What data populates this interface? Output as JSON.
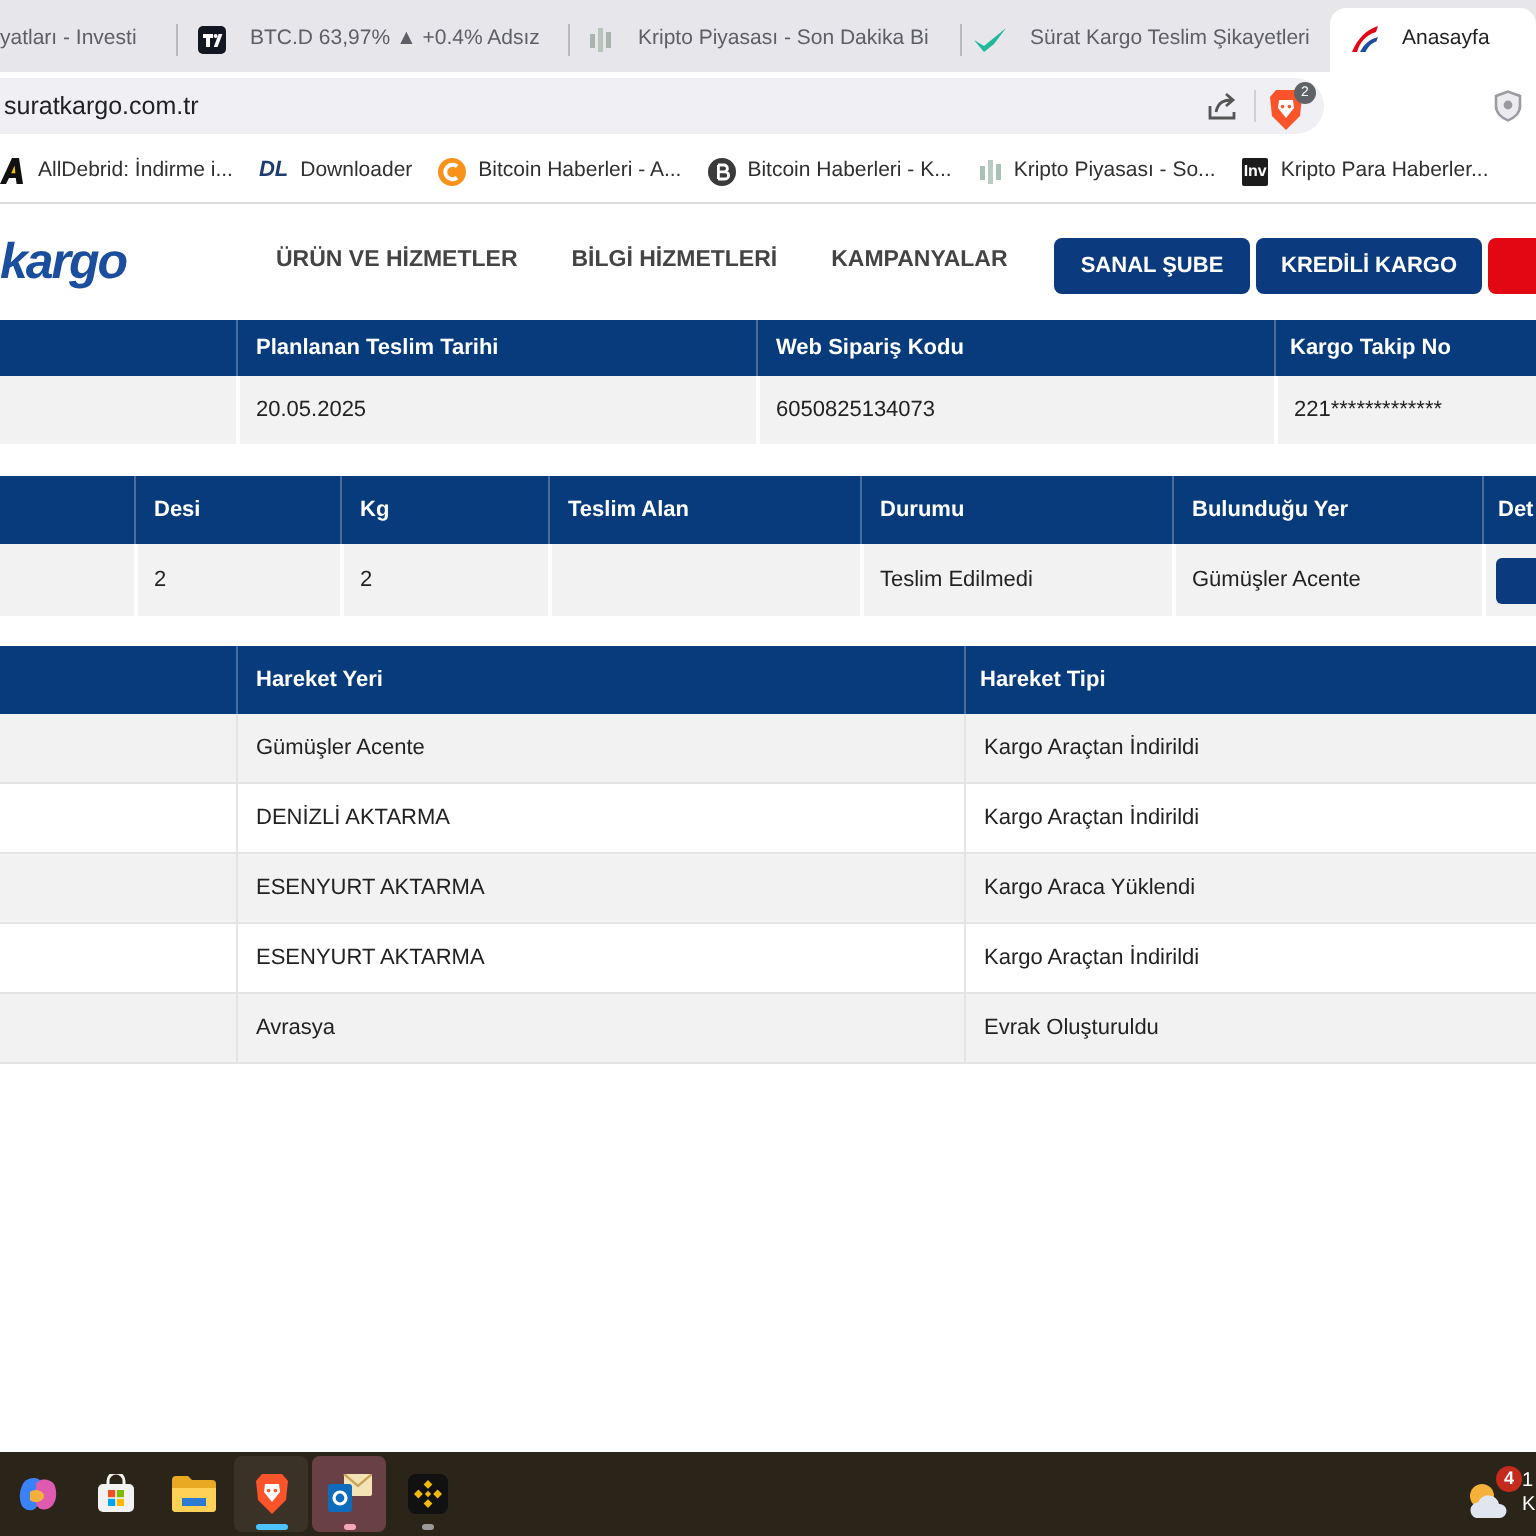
{
  "browser": {
    "tabs": [
      {
        "title": "yatları - Investi",
        "selected": false
      },
      {
        "title": "BTC.D 63,97% ▲ +0.4% Adsız",
        "selected": false
      },
      {
        "title": "Kripto Piyasası - Son Dakika Bi",
        "selected": false
      },
      {
        "title": "Sürat Kargo Teslim Şikayetleri",
        "selected": false
      },
      {
        "title": "Anasayfa",
        "selected": true
      }
    ],
    "address_bar": {
      "url": "suratkargo.com.tr",
      "shields_badge": "2"
    },
    "bookmarks": [
      {
        "title": "AllDebrid: İndirme i..."
      },
      {
        "title": "Downloader",
        "logo_text": "DL"
      },
      {
        "title": "Bitcoin Haberleri - A..."
      },
      {
        "title": "Bitcoin Haberleri - K..."
      },
      {
        "title": "Kripto Piyasası - So..."
      },
      {
        "title": "Kripto Para Haberler...",
        "logo_text": "Inv"
      }
    ]
  },
  "site_header": {
    "logo": "kargo",
    "nav": [
      "ÜRÜN VE HİZMETLER",
      "BİLGİ HİZMETLERİ",
      "KAMPANYALAR"
    ],
    "buttons": [
      "SANAL ŞUBE",
      "KREDİLİ KARGO"
    ]
  },
  "shipment_table": {
    "columns": [
      "Planlanan Teslim Tarihi",
      "Web Sipariş Kodu",
      "Kargo Takip No"
    ],
    "rows": [
      [
        "20.05.2025",
        "6050825134073",
        "221*************"
      ]
    ]
  },
  "package_table": {
    "columns": [
      "Desi",
      "Kg",
      "Teslim Alan",
      "Durumu",
      "Bulunduğu Yer",
      "Det"
    ],
    "rows": [
      [
        "2",
        "2",
        null,
        "Teslim Edilmedi",
        "Gümüşler Acente"
      ]
    ]
  },
  "movements_table": {
    "columns": [
      "Hareket Yeri",
      "Hareket Tipi"
    ],
    "rows": [
      [
        "Gümüşler Acente",
        "Kargo Araçtan İndirildi"
      ],
      [
        "DENİZLİ AKTARMA",
        "Kargo Araçtan İndirildi"
      ],
      [
        "ESENYURT AKTARMA",
        "Kargo Araca Yüklendi"
      ],
      [
        "ESENYURT AKTARMA",
        "Kargo Araçtan İndirildi"
      ],
      [
        "Avrasya",
        "Evrak Oluşturuldu"
      ]
    ]
  },
  "taskbar": {
    "apps": [
      {
        "running": false,
        "active": false,
        "highlighted": false
      },
      {
        "running": false,
        "active": false,
        "highlighted": false
      },
      {
        "running": false,
        "active": false,
        "highlighted": false
      },
      {
        "running": true,
        "active": true,
        "highlighted": false
      },
      {
        "running": true,
        "active": false,
        "highlighted": true
      },
      {
        "running": true,
        "active": false,
        "highlighted": false
      }
    ],
    "weather_badge": "4",
    "clock_partial": [
      "1",
      "K"
    ]
  }
}
